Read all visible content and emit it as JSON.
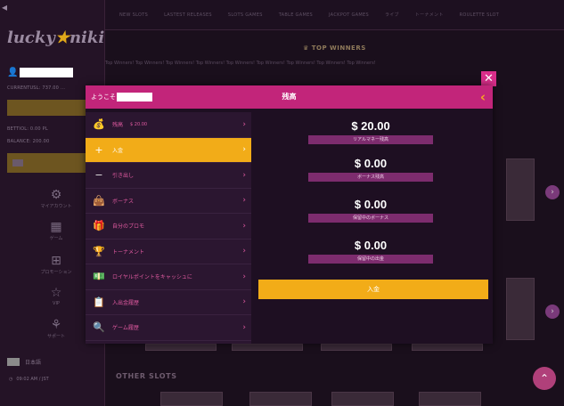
{
  "sidebar": {
    "logo_main": "lucky",
    "logo_accent": "niki",
    "currency_line": "CURRENTUSL: 737.00 ...",
    "bet_line": "BETTIOL: 0.00 PL",
    "balance_line": "BALANCE: 200.00",
    "nav": [
      {
        "icon": "⚙",
        "label": "マイアカウント"
      },
      {
        "icon": "▦",
        "label": "ゲーム"
      },
      {
        "icon": "⊞",
        "label": "プロモーション"
      },
      {
        "icon": "☆",
        "label": "VIP"
      },
      {
        "icon": "⚘",
        "label": "サポート"
      }
    ],
    "language": "日本語",
    "time": "09:02 AM / JST"
  },
  "topnav": {
    "items": [
      "NEW SLOTS",
      "LASTEST RELEASES",
      "SLOTS GAMES",
      "TABLE GAMES",
      "JACKPOT GAMES",
      "ライブ",
      "",
      "トーナメント",
      "ROULETTE SLOT"
    ]
  },
  "top_winners": "TOP WINNERS",
  "ticker": "Top Winners!  Top Winners!  Top Winners!  Top Winners!  Top Winners!  Top Winners!  Top Winners!  Top Winners!  Top Winners!",
  "other_slots": "OTHER SLOTS",
  "modal": {
    "welcome": "ようこそ",
    "title": "残高",
    "menu": [
      {
        "icon": "💰",
        "label": "残高",
        "sub": "$ 20.00",
        "active": false
      },
      {
        "icon": "+",
        "label": "入金",
        "sub": "",
        "active": true
      },
      {
        "icon": "−",
        "label": "引き出し",
        "sub": "",
        "active": false
      },
      {
        "icon": "👜",
        "label": "ボーナス",
        "sub": "",
        "active": false
      },
      {
        "icon": "🎁",
        "label": "自分のプロモ",
        "sub": "",
        "active": false
      },
      {
        "icon": "🏆",
        "label": "トーナメント",
        "sub": "",
        "active": false
      },
      {
        "icon": "💵",
        "label": "ロイヤルポイントをキャッシュに",
        "sub": "",
        "active": false
      },
      {
        "icon": "📋",
        "label": "入出金履歴",
        "sub": "",
        "active": false
      },
      {
        "icon": "🔍",
        "label": "ゲーム履歴",
        "sub": "",
        "active": false
      }
    ],
    "balances": [
      {
        "amount": "$ 20.00",
        "label": "リアルマネー残高"
      },
      {
        "amount": "$ 0.00",
        "label": "ボーナス残高"
      },
      {
        "amount": "$ 0.00",
        "label": "保留中のボーナス"
      },
      {
        "amount": "$ 0.00",
        "label": "保留中の出金"
      }
    ],
    "deposit_button": "入金"
  },
  "colors": {
    "modal_header": "#c2257a",
    "active_item": "#f2ac18",
    "background": "#1a0f1c"
  }
}
